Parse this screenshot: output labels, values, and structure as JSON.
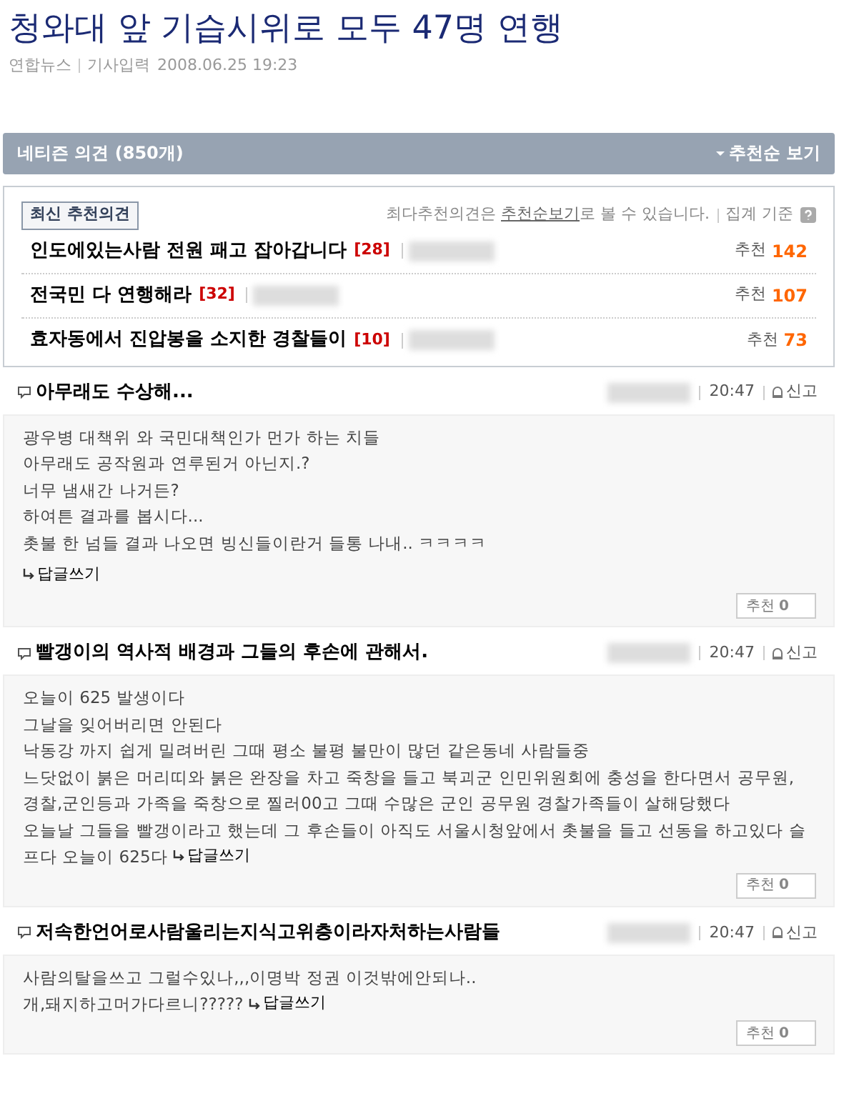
{
  "article": {
    "title": "청와대 앞 기습시위로 모두 47명 연행",
    "source": "연합뉴스",
    "date_label": "기사입력",
    "date": "2008.06.25 19:23"
  },
  "comments_header": {
    "title": "네티즌 의견 (850개)",
    "sort_link": "추천순 보기"
  },
  "best": {
    "tab": "최신 추천의견",
    "notice": "최다추천의견은 ",
    "notice_link": "추천순보기",
    "notice_tail": "로 볼 수 있습니다.",
    "criteria": "집계 기준",
    "items": [
      {
        "title": "인도에있는사람 전원 패고 잡아갑니다",
        "count": "[28]",
        "vote_label": "추천",
        "votes": "142"
      },
      {
        "title": "전국민 다 연행해라",
        "count": "[32]",
        "vote_label": "추천",
        "votes": "107"
      },
      {
        "title": "효자동에서 진압봉을 소지한 경찰들이",
        "count": "[10]",
        "vote_label": "추천",
        "votes": "73"
      }
    ]
  },
  "comments": [
    {
      "title": "아무래도 수상해...",
      "time": "20:47",
      "report": "신고",
      "lines": [
        "광우병 대책위 와 국민대책인가 먼가 하는 치들",
        "아무래도 공작원과 연루된거 아닌지.?",
        "너무 냄새간 나거든?",
        "하여튼 결과를 봅시다...",
        "촛불 한 넘들 결과 나오면 빙신들이란거 들통 나내.. ㅋㅋㅋㅋ"
      ],
      "reply_inline": false,
      "reply": "답글쓰기",
      "vote_label": "추천",
      "votes": "0"
    },
    {
      "title": "빨갱이의 역사적 배경과 그들의 후손에 관해서.",
      "time": "20:47",
      "report": "신고",
      "lines": [
        "오늘이 625 발생이다",
        "그날을 잊어버리면 안된다",
        "낙동강 까지 쉽게 밀려버린 그때 평소 불평 불만이 많던 같은동네 사람들중",
        "느닷없이 붉은 머리띠와 붉은 완장을 차고 죽창을 들고 북괴군 인민위원회에 충성을 한다면서 공무원,",
        "경찰,군인등과 가족을 죽창으로 찔러00고 그때 수많은 군인 공무원 경찰가족들이 살해당했다",
        "오늘날 그들을 빨갱이라고 했는데 그 후손들이 아직도 서울시청앞에서 촛불을 들고 선동을 하고있다 슬",
        "프다 오늘이 625다"
      ],
      "reply_inline": true,
      "reply": "답글쓰기",
      "vote_label": "추천",
      "votes": "0"
    },
    {
      "title": "저속한언어로사람울리는지식고위층이라자처하는사람들",
      "time": "20:47",
      "report": "신고",
      "lines": [
        "사람의탈을쓰고 그럴수있나,,,이명박 정권 이것밖에안되나..",
        "개,돼지하고머가다르니?????"
      ],
      "reply_inline": true,
      "reply": "답글쓰기",
      "vote_label": "추천",
      "votes": "0"
    }
  ]
}
